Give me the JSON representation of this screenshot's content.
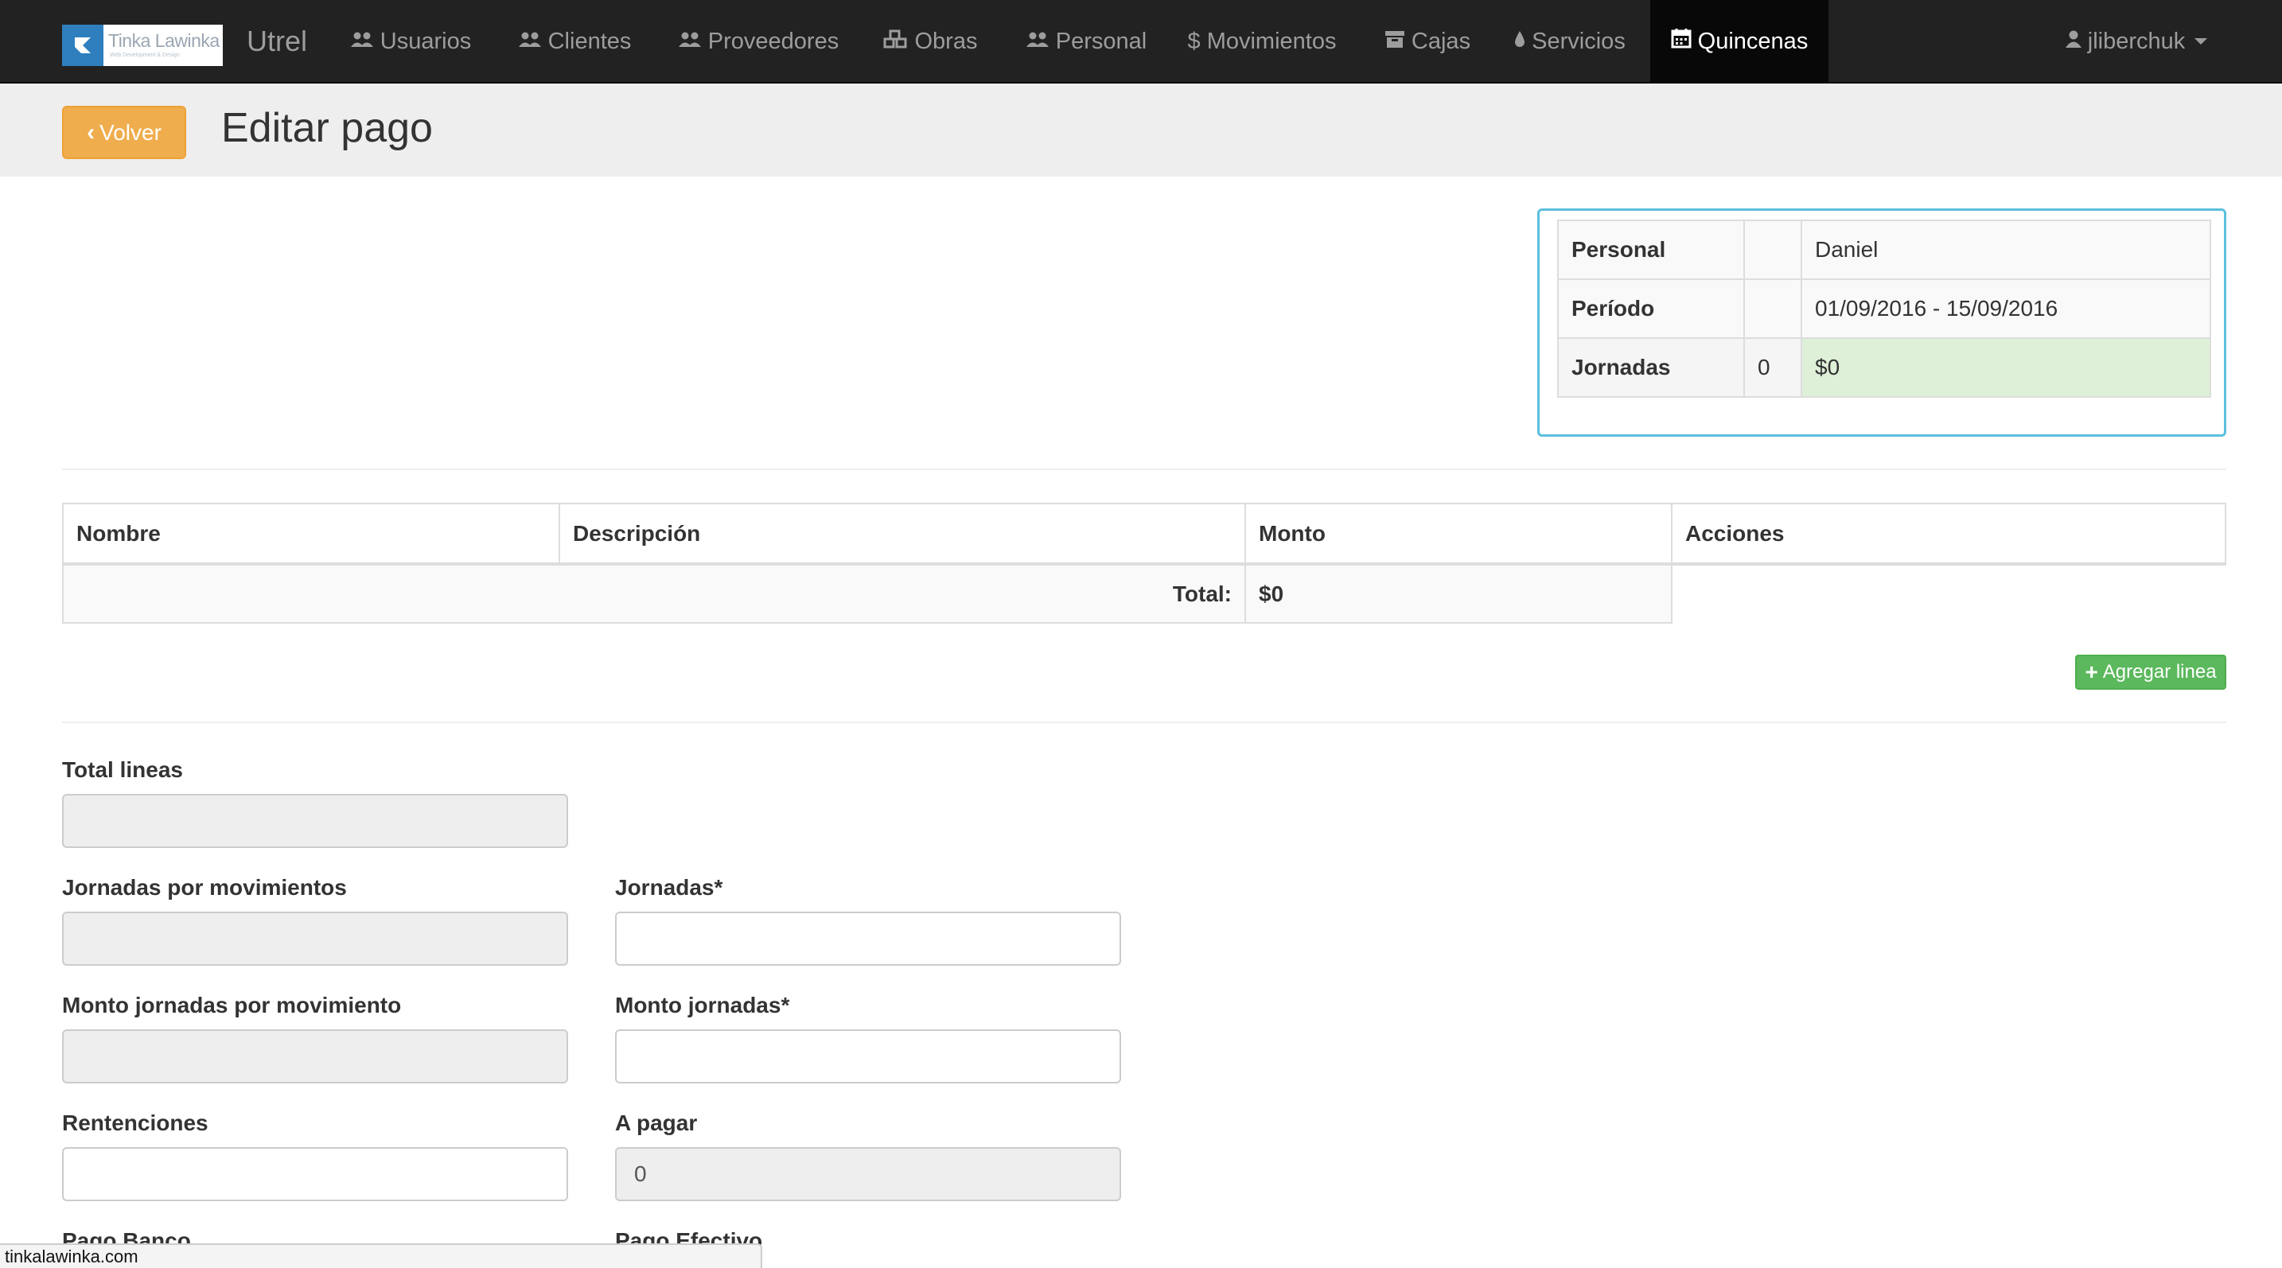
{
  "navbar": {
    "logo_text": "Tinka Lawinka",
    "logo_subtext": "Web Development & Design",
    "brand": "Utrel",
    "items": [
      {
        "label": "Usuarios",
        "icon": "users-icon"
      },
      {
        "label": "Clientes",
        "icon": "users-icon"
      },
      {
        "label": "Proveedores",
        "icon": "users-icon"
      },
      {
        "label": "Obras",
        "icon": "cubes-icon"
      },
      {
        "label": "Personal",
        "icon": "users-icon"
      },
      {
        "label": "$ Movimientos",
        "icon": "dollar-icon"
      },
      {
        "label": "Cajas",
        "icon": "archive-icon"
      },
      {
        "label": "Servicios",
        "icon": "drop-icon"
      },
      {
        "label": "Quincenas",
        "icon": "calendar-icon",
        "active": true
      }
    ],
    "user": {
      "label": "jliberchuk",
      "icon": "user-icon"
    }
  },
  "header": {
    "back_label": "Volver",
    "title": "Editar pago"
  },
  "info": {
    "personal_label": "Personal",
    "personal_mid": "",
    "personal_value": "Daniel",
    "periodo_label": "Período",
    "periodo_mid": "",
    "periodo_value": "01/09/2016 - 15/09/2016",
    "jornadas_label": "Jornadas",
    "jornadas_count": "0",
    "jornadas_value": "$0"
  },
  "lines_table": {
    "headers": [
      "Nombre",
      "Descripción",
      "Monto",
      "Acciones"
    ],
    "total_label": "Total:",
    "total_value": "$0"
  },
  "add_line_label": "Agregar linea",
  "form": {
    "total_lineas": {
      "label": "Total lineas",
      "value": ""
    },
    "jornadas_por_mov": {
      "label": "Jornadas por movimientos",
      "value": ""
    },
    "jornadas": {
      "label": "Jornadas*",
      "value": ""
    },
    "monto_jornadas_por_mov": {
      "label": "Monto jornadas por movimiento",
      "value": ""
    },
    "monto_jornadas": {
      "label": "Monto jornadas*",
      "value": ""
    },
    "retenciones": {
      "label": "Rentenciones",
      "value": ""
    },
    "a_pagar": {
      "label": "A pagar",
      "value": "0"
    },
    "pago_banco": {
      "label": "Pago Banco"
    },
    "pago_efectivo": {
      "label": "Pago Efectivo"
    }
  },
  "status_bar": "tinkalawinka.com",
  "colors": {
    "navbar": "#222222",
    "active_nav": "#080808",
    "back_button": "#f0ad4e",
    "add_button": "#5cb85c",
    "panel_border": "#5bc0de",
    "success_cell": "#dff0d8"
  }
}
